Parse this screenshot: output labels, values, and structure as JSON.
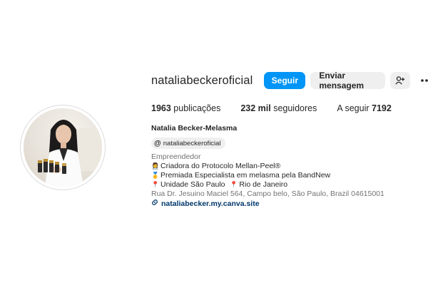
{
  "profile": {
    "username": "nataliabeckeroficial",
    "follow_label": "Seguir",
    "message_label": "Enviar mensagem",
    "suggest_icon": "person-add-icon",
    "more_icon": "more-horizontal-icon"
  },
  "stats": {
    "posts_count": "1963",
    "posts_label": "publicações",
    "followers_count": "232 mil",
    "followers_label": "seguidores",
    "following_label": "A seguir",
    "following_count": "7192"
  },
  "bio": {
    "full_name": "Natalia Becker-Melasma",
    "threads_handle": "nataliabeckeroficial",
    "category": "Empreendedor",
    "lines": [
      {
        "emoji": "👩‍⚕️",
        "text": "Criadora do Protocolo Mellan-Peel®"
      },
      {
        "emoji": "🥇",
        "text": "Premiada Especialista em melasma pela BandNew"
      },
      {
        "emoji": "📍",
        "text": "Unidade São Paulo",
        "emoji2": "📍",
        "text2": "Rio de Janeiro"
      }
    ],
    "address": "Rua Dr. Jesuino Maciel 564, Campo belo, São Paulo, Brazil 04615001",
    "link": "nataliabecker.my.canva.site"
  },
  "colors": {
    "follow_button": "#0095f6",
    "secondary_button": "#efefef",
    "link": "#00376b",
    "muted_text": "#737373"
  }
}
